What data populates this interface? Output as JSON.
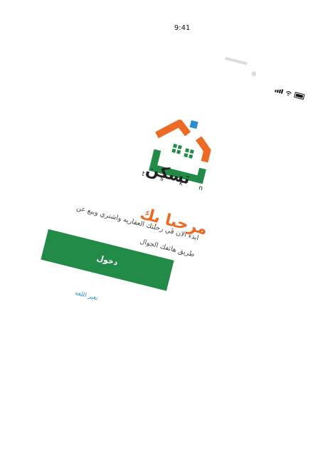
{
  "status_bar": {
    "time": "9:41"
  },
  "brand": {
    "name_ar": "تسكن",
    "name_latin": "t s k n",
    "colors": {
      "orange": "#ec6a24",
      "green": "#218b47",
      "blue": "#2b8fcf"
    }
  },
  "welcome": {
    "title": "مرحبا بك",
    "description": "ابدء الان في رحلتك العقاريه واشتري وبيع عن طريق هاتفك الجوال"
  },
  "actions": {
    "login_label": "دخول",
    "change_language_label": "تغير اللغه"
  },
  "icons": [
    "signal-icon",
    "wifi-icon",
    "battery-icon",
    "house-logo-icon"
  ]
}
